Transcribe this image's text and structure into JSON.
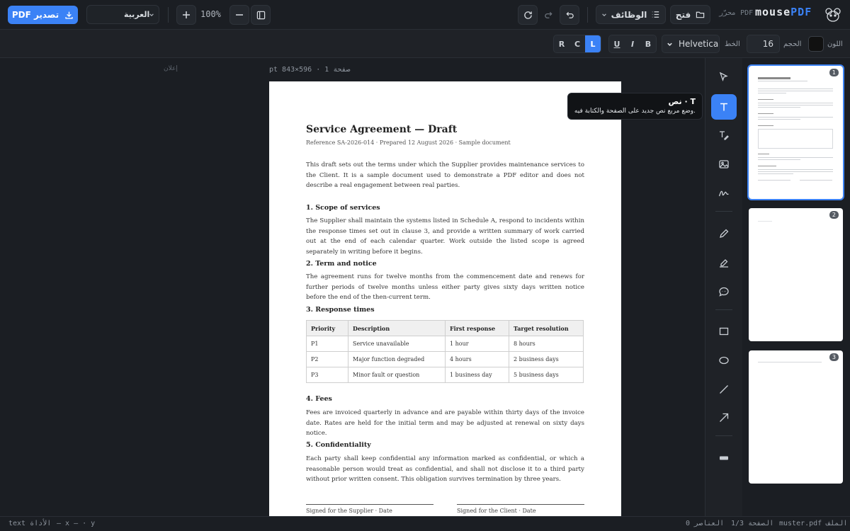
{
  "topbar": {
    "export_label": "PDF تصدير",
    "language": "العربية",
    "zoom": "100%",
    "functions_label": "الوظائف",
    "open_label": "فتح",
    "editor_label": "محرّر PDF",
    "brand_main": "mouse",
    "brand_accent": "PDF"
  },
  "format": {
    "align": [
      "R",
      "C",
      "L"
    ],
    "style": [
      "U",
      "I",
      "B"
    ],
    "font_label": "الخط",
    "font": "Helvetica",
    "size_label": "الحجم",
    "size": "16",
    "color_label": "اللون",
    "color": "#111111"
  },
  "canvas": {
    "ad_label": "إعلان",
    "page_info": "pt 843×596 · 1 صفحة"
  },
  "document": {
    "title": "Service Agreement — Draft",
    "reference": "Reference SA-2026-014 · Prepared 12 August 2026 · Sample document",
    "intro": "This draft sets out the terms under which the Supplier provides maintenance services to the Client. It is a sample document used to demonstrate a PDF editor and does not describe a real engagement between real parties.",
    "sections": [
      {
        "heading": "1. Scope of services",
        "body": "The Supplier shall maintain the systems listed in Schedule A, respond to incidents within the response times set out in clause 3, and provide a written summary of work carried out at the end of each calendar quarter. Work outside the listed scope is agreed separately in writing before it begins."
      },
      {
        "heading": "2. Term and notice",
        "body": "The agreement runs for twelve months from the commencement date and renews for further periods of twelve months unless either party gives sixty days written notice before the end of the then-current term."
      },
      {
        "heading": "3. Response times",
        "body": ""
      },
      {
        "heading": "4. Fees",
        "body": "Fees are invoiced quarterly in advance and are payable within thirty days of the invoice date. Rates are held for the initial term and may be adjusted at renewal on sixty days notice."
      },
      {
        "heading": "5. Confidentiality",
        "body": "Each party shall keep confidential any information marked as confidential, or which a reasonable person would treat as confidential, and shall not disclose it to a third party without prior written consent. This obligation survives termination by three years."
      }
    ],
    "table": {
      "headers": [
        "Priority",
        "Description",
        "First response",
        "Target resolution"
      ],
      "rows": [
        [
          "P1",
          "Service unavailable",
          "1 hour",
          "8 hours"
        ],
        [
          "P2",
          "Major function degraded",
          "4 hours",
          "2 business days"
        ],
        [
          "P3",
          "Minor fault or question",
          "1 business day",
          "5 business days"
        ]
      ]
    },
    "sign_supplier": "Signed for the Supplier · Date",
    "sign_client": "Signed for the Client · Date"
  },
  "tooltip": {
    "title": "نص · T",
    "description": "وضع مربع نص جديد على الصفحة والكتابة فيه."
  },
  "tools": [
    "select-icon",
    "text-icon",
    "text-edit-icon",
    "image-icon",
    "signature-icon",
    "pen-icon",
    "highlighter-icon",
    "comment-icon",
    "rectangle-icon",
    "ellipse-icon",
    "line-icon",
    "arrow-icon",
    "whiteout-icon"
  ],
  "thumbnails": [
    "1",
    "2",
    "3"
  ],
  "status": {
    "tool": "text الأداة",
    "coords": "— x — · y",
    "elements": "0 العناصر",
    "page": "1/3 الصفحة",
    "file": "muster.pdf الملف"
  }
}
